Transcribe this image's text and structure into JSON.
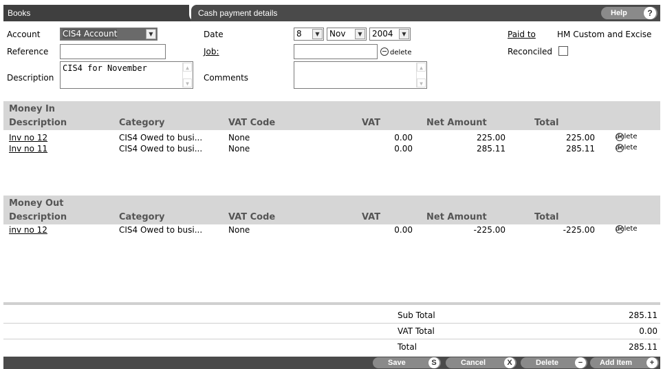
{
  "header": {
    "books_tab": "Books",
    "cash_tab": "Cash payment details",
    "help_label": "Help",
    "help_icon": "?"
  },
  "form": {
    "account_label": "Account",
    "account_value": "CIS4 Account",
    "reference_label": "Reference",
    "reference_value": "",
    "description_label": "Description",
    "description_value": "CIS4 for November",
    "date_label": "Date",
    "date_day": "8",
    "date_month": "Nov",
    "date_year": "2004",
    "job_label": "Job:",
    "job_value": "",
    "job_delete": "delete",
    "comments_label": "Comments",
    "comments_value": "",
    "paid_to_label": "Paid to",
    "paid_to_value": "HM Custom and Excise",
    "reconciled_label": "Reconciled",
    "reconciled_checked": false
  },
  "columns": {
    "description": "Description",
    "category": "Category",
    "vat_code": "VAT Code",
    "vat": "VAT",
    "net_amount": "Net Amount",
    "total": "Total"
  },
  "money_in": {
    "title": "Money In",
    "rows": [
      {
        "description": "Inv no 12",
        "category": "CIS4 Owed to busi...",
        "vat_code": "None",
        "vat": "0.00",
        "net": "225.00",
        "total": "225.00",
        "delete": "delete"
      },
      {
        "description": "Inv no 11",
        "category": "CIS4 Owed to busi...",
        "vat_code": "None",
        "vat": "0.00",
        "net": "285.11",
        "total": "285.11",
        "delete": "delete"
      }
    ]
  },
  "money_out": {
    "title": "Money Out",
    "rows": [
      {
        "description": "inv no 12",
        "category": "CIS4 Owed to busi...",
        "vat_code": "None",
        "vat": "0.00",
        "net": "-225.00",
        "total": "-225.00",
        "delete": "delete"
      }
    ]
  },
  "totals": {
    "sub_total_label": "Sub Total",
    "sub_total": "285.11",
    "vat_total_label": "VAT Total",
    "vat_total": "0.00",
    "total_label": "Total",
    "total": "285.11"
  },
  "actions": {
    "save": "Save",
    "save_icon": "S",
    "cancel": "Cancel",
    "cancel_icon": "X",
    "delete": "Delete",
    "add_item": "Add Item"
  }
}
